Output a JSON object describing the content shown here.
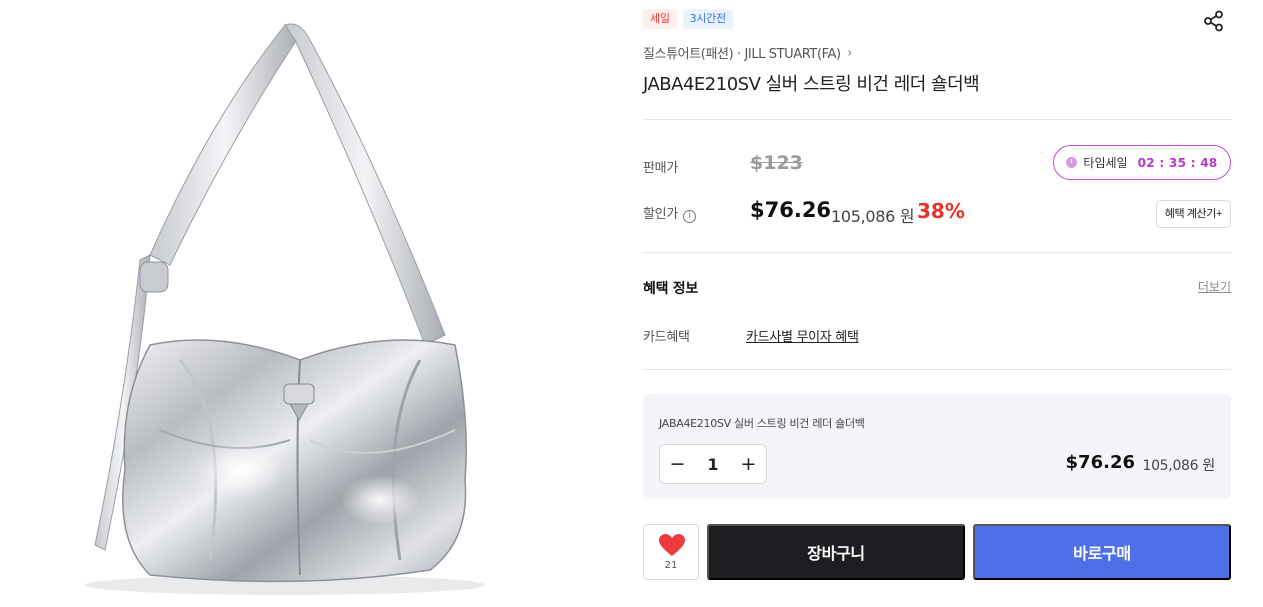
{
  "badges": {
    "sale": "세일",
    "time": "3시간전"
  },
  "icons": {
    "share": "share-icon",
    "chevron": "chevron-right-icon",
    "info": "info-icon",
    "clock": "clock-icon",
    "minus": "minus-icon",
    "plus": "plus-icon",
    "heart": "heart-icon"
  },
  "brand": {
    "name": "질스튜어트(패션) · JILL STUART(FA)",
    "chevron": "›"
  },
  "product": {
    "title": "JABA4E210SV 실버 스트링 비건 레더 숄더백"
  },
  "price": {
    "sale_label": "판매가",
    "original": "$123",
    "discount_label": "할인가",
    "info_glyph": "i",
    "discounted": "$76.26",
    "krw": "105,086 원",
    "discount_rate": "38%"
  },
  "timesale": {
    "label": "타임세일",
    "timer": "02 : 35 : 48"
  },
  "benefit_calc": {
    "label": "혜택 계산기+"
  },
  "benefits": {
    "title": "혜택 정보",
    "more": "더보기",
    "card_label": "카드혜택",
    "card_link": "카드사별 무이자 혜택"
  },
  "option": {
    "name": "JABA4E210SV 실버 스트링 비건 레더 숄더백",
    "minus": "−",
    "quantity": "1",
    "plus": "+",
    "price": "$76.26",
    "krw": "105,086 원"
  },
  "actions": {
    "like_count": "21",
    "cart": "장바구니",
    "buy": "바로구매"
  },
  "colors": {
    "accent_blue": "#4f6fe8",
    "cart_dark": "#1e1e22",
    "discount_red": "#e8322c",
    "timesale_purple": "#b43acb",
    "heart_red": "#ee3b3b"
  }
}
